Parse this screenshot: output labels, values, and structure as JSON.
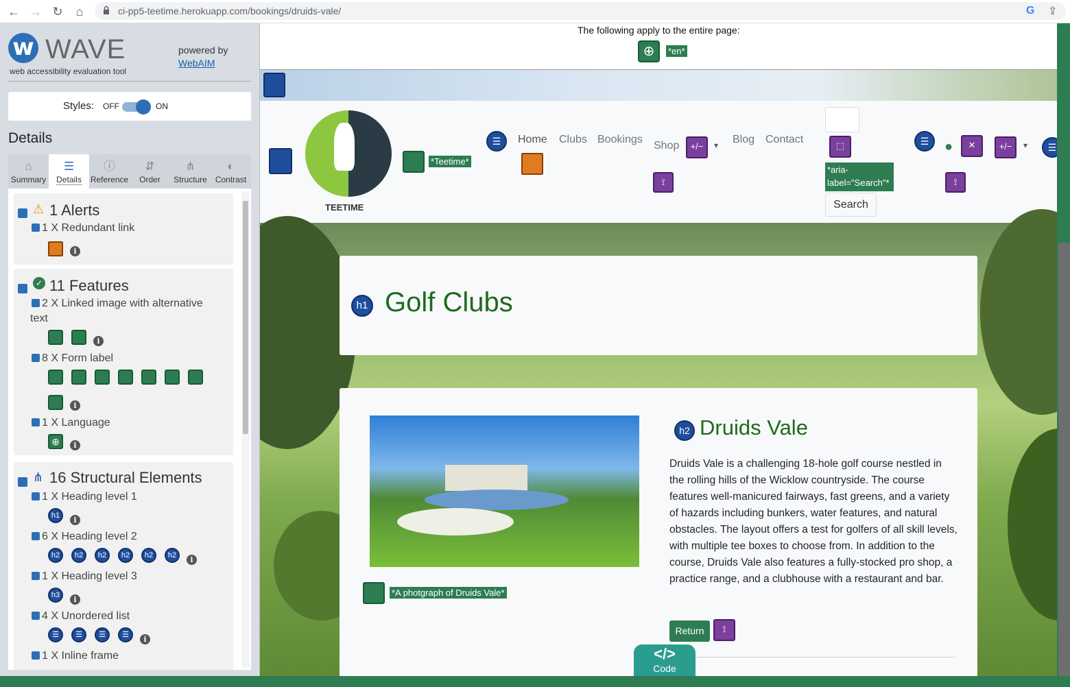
{
  "browser": {
    "url_host": "ci-pp5-teetime.herokuapp.com",
    "url_path": "/bookings/druids-vale/"
  },
  "wave": {
    "logo_letter": "w",
    "name": "WAVE",
    "subtitle": "web accessibility evaluation tool",
    "powered_by": "powered by",
    "webaim": "WebAIM",
    "styles_label": "Styles:",
    "styles_off": "OFF",
    "styles_on": "ON",
    "details_title": "Details",
    "tabs": [
      {
        "label": "Summary",
        "icon": "home-icon"
      },
      {
        "label": "Details",
        "icon": "list-icon"
      },
      {
        "label": "Reference",
        "icon": "info-icon"
      },
      {
        "label": "Order",
        "icon": "order-icon"
      },
      {
        "label": "Structure",
        "icon": "structure-icon"
      },
      {
        "label": "Contrast",
        "icon": "contrast-icon"
      }
    ],
    "alerts": {
      "title": "1 Alerts",
      "items": [
        "1 X Redundant link"
      ]
    },
    "features": {
      "title": "11 Features",
      "items": [
        "2 X Linked image with alternative",
        "text",
        "8 X Form label",
        "1 X Language"
      ]
    },
    "structure": {
      "title": "16 Structural Elements",
      "items": [
        "1 X Heading level 1",
        "6 X Heading level 2",
        "1 X Heading level 3",
        "4 X Unordered list",
        "1 X Inline frame"
      ]
    }
  },
  "page": {
    "apply_text": "The following apply to the entire page:",
    "lang_label": "*en*",
    "logo_text": "TEETIME",
    "logo_alt": "*Teetime*",
    "nav": [
      "Home",
      "Clubs",
      "Bookings",
      "Shop",
      "Blog",
      "Contact"
    ],
    "aria_label": "*aria-label=\"Search\"*",
    "search_button": "Search",
    "h1_badge": "h1",
    "h1": "Golf Clubs",
    "h2_badge": "h2",
    "h2": "Druids Vale",
    "description": "Druids Vale is a challenging 18-hole golf course nestled in the rolling hills of the Wicklow countryside. The course features well-manicured fairways, fast greens, and a variety of hazards including bunkers, water features, and natural obstacles. The layout offers a test for golfers of all skill levels, with multiple tee boxes to choose from. In addition to the course, Druids Vale also features a fully-stocked pro shop, a practice range, and a clubhouse with a restaurant and bar.",
    "photo_alt": "*A photgraph of Druids Vale*",
    "return_button": "Return",
    "code_symbol": "</>",
    "code_label": "Code"
  },
  "colors": {
    "wave_blue": "#2c6fb6",
    "feature_green": "#2e7d52",
    "heading_green": "#1e6b1e",
    "alert_orange": "#e07b20",
    "aria_purple": "#7b3f9e",
    "code_teal": "#2a9d8f"
  }
}
